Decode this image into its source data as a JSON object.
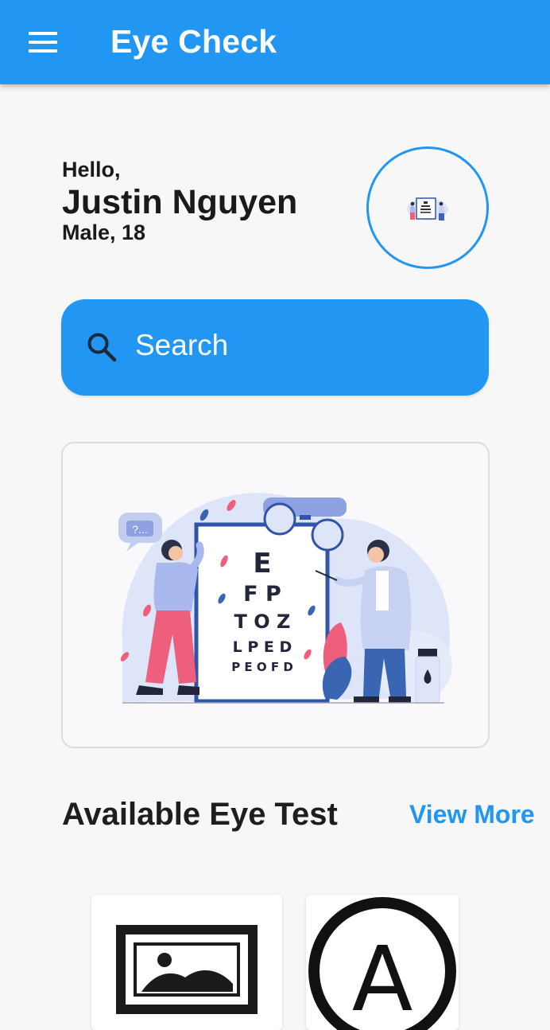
{
  "app_bar": {
    "title": "Eye Check",
    "menu_icon": "menu-icon",
    "color": "#2196f3"
  },
  "profile": {
    "greeting": "Hello,",
    "name": "Justin Nguyen",
    "details": "Male, 18",
    "avatar_icon": "eye-exam-illustration"
  },
  "search": {
    "label": "Search",
    "icon": "search-icon"
  },
  "banner": {
    "illustration": "eye-exam-illustration",
    "chart_rows": [
      "E",
      "F P",
      "T O Z",
      "L P E D",
      "P E O F D"
    ],
    "speech_bubble": "?..."
  },
  "eye_tests": {
    "title": "Available Eye Test",
    "view_more_label": "View More",
    "items": [
      {
        "icon": "image-placeholder-icon"
      },
      {
        "icon": "letter-a-circle-icon",
        "glyph": "A"
      }
    ]
  },
  "colors": {
    "accent": "#2196f3",
    "background": "#f7f7f7",
    "text": "#1e1e1e"
  }
}
